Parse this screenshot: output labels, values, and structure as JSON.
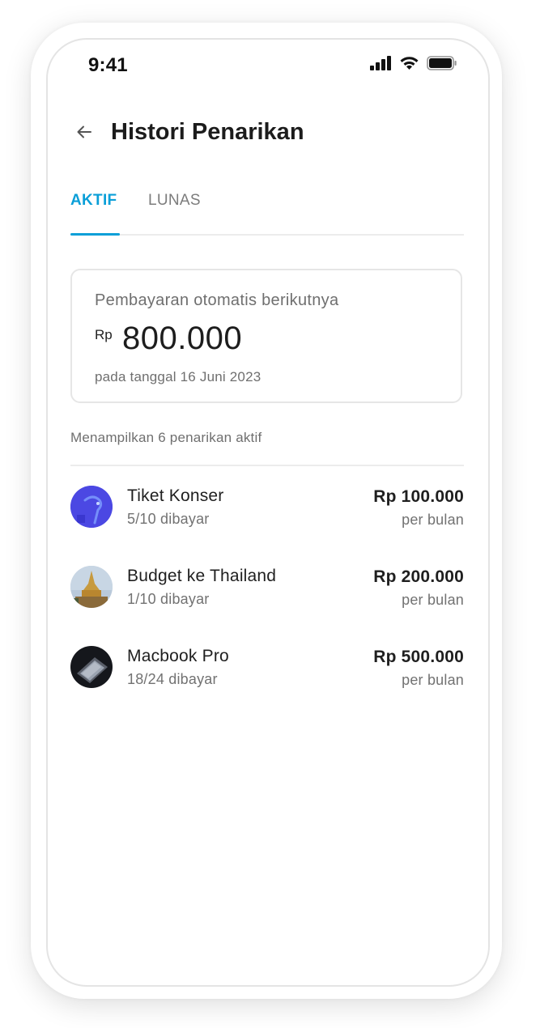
{
  "status_bar": {
    "time": "9:41"
  },
  "header": {
    "back_icon": "arrow-left-icon",
    "title": "Histori Penarikan"
  },
  "tabs": [
    {
      "label": "AKTIF",
      "active": true
    },
    {
      "label": "LUNAS",
      "active": false
    }
  ],
  "summary": {
    "label": "Pembayaran otomatis berikutnya",
    "currency": "Rp",
    "amount": "800.000",
    "date_text": "pada tanggal 16 Juni 2023"
  },
  "list": {
    "caption": "Menampilkan 6 penarikan aktif",
    "items": [
      {
        "title": "Tiket Konser",
        "progress": "5/10 dibayar",
        "amount": "Rp 100.000",
        "period": "per bulan",
        "thumbnail": "concert-photo"
      },
      {
        "title": "Budget ke Thailand",
        "progress": "1/10 dibayar",
        "amount": "Rp 200.000",
        "period": "per bulan",
        "thumbnail": "thai-temple-photo"
      },
      {
        "title": "Macbook Pro",
        "progress": "18/24 dibayar",
        "amount": "Rp 500.000",
        "period": "per bulan",
        "thumbnail": "laptop-photo"
      }
    ]
  },
  "colors": {
    "accent": "#0a9fd8",
    "text_primary": "#1f1f1f",
    "text_secondary": "#6f6f6f",
    "border": "#e6e6e6"
  }
}
